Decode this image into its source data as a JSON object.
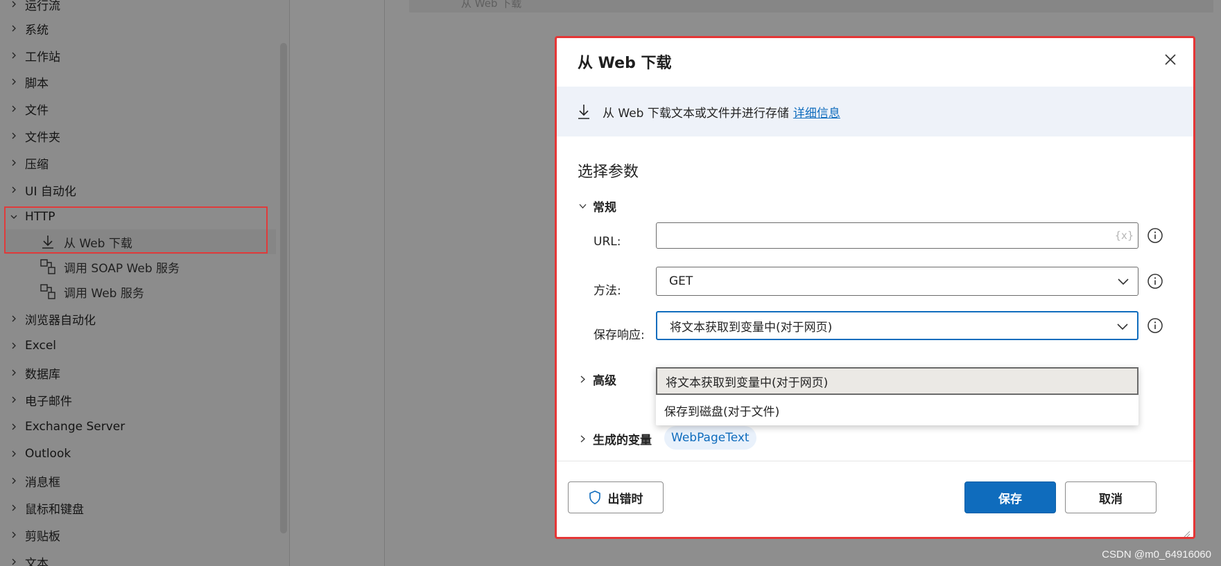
{
  "sidebar": {
    "groups": [
      {
        "label": "运行流"
      },
      {
        "label": "系统"
      },
      {
        "label": "工作站"
      },
      {
        "label": "脚本"
      },
      {
        "label": "文件"
      },
      {
        "label": "文件夹"
      },
      {
        "label": "压缩"
      },
      {
        "label": "UI 自动化"
      },
      {
        "label": "HTTP"
      },
      {
        "label": "浏览器自动化"
      },
      {
        "label": "Excel"
      },
      {
        "label": "数据库"
      },
      {
        "label": "电子邮件"
      },
      {
        "label": "Exchange Server"
      },
      {
        "label": "Outlook"
      },
      {
        "label": "消息框"
      },
      {
        "label": "鼠标和键盘"
      },
      {
        "label": "剪贴板"
      },
      {
        "label": "文本"
      }
    ],
    "http_actions": [
      {
        "label": "从 Web 下载",
        "icon": "download-icon"
      },
      {
        "label": "调用 SOAP Web 服务",
        "icon": "web-service-icon"
      },
      {
        "label": "调用 Web 服务",
        "icon": "web-service-icon"
      }
    ]
  },
  "canvas": {
    "step_label": "从 Web 下载"
  },
  "dialog": {
    "title": "从 Web 下载",
    "info_text": "从 Web 下载文本或文件并进行存储",
    "info_link": "详细信息",
    "section_title": "选择参数",
    "general_group": "常规",
    "fields": {
      "url_label": "URL:",
      "url_value": "",
      "var_button": "{x}",
      "method_label": "方法:",
      "method_value": "GET",
      "save_label": "保存响应:",
      "save_value": "将文本获取到变量中(对于网页)"
    },
    "save_options": [
      "将文本获取到变量中(对于网页)",
      "保存到磁盘(对于文件)"
    ],
    "advanced_group": "高级",
    "variables_group": "生成的变量",
    "variable_chip": "WebPageText",
    "buttons": {
      "on_error": "出错时",
      "save": "保存",
      "cancel": "取消"
    }
  },
  "watermark": "CSDN @m0_64916060",
  "colors": {
    "accent": "#0f6cbd",
    "highlight_border": "#e53636",
    "info_bar": "#eef2f9"
  }
}
